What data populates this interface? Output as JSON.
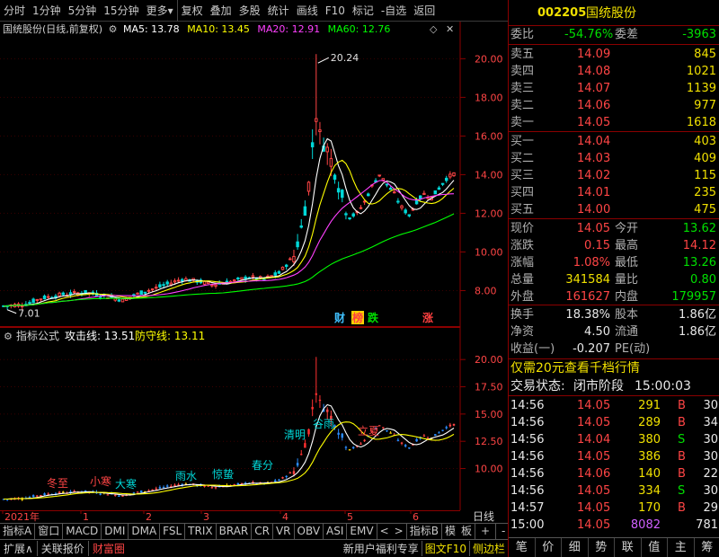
{
  "toolbar": {
    "items": [
      "分时",
      "1分钟",
      "5分钟",
      "15分钟",
      "更多",
      "复权",
      "叠加",
      "多股",
      "统计",
      "画线",
      "F10",
      "标记",
      "-自选",
      "返回"
    ],
    "more_arrow": "▾"
  },
  "main_info": {
    "title": "国统股份(日线,前复权)",
    "ma5": "MA5: 13.78",
    "ma10": "MA10: 13.45",
    "ma20": "MA20: 12.91",
    "ma60": "MA60: 12.76",
    "colors": {
      "ma5": "#ffffff",
      "ma10": "#ffff00",
      "ma20": "#ff40ff",
      "ma60": "#00ff00"
    }
  },
  "main_chart": {
    "y_ticks": [
      "20.00",
      "18.00",
      "16.00",
      "14.00",
      "12.00",
      "10.00",
      "8.00"
    ],
    "y_values": [
      20,
      18,
      16,
      14,
      12,
      10,
      8
    ],
    "high_label": "20.24",
    "low_label": "7.01",
    "ymin": 6.3,
    "ymax": 20.9,
    "markers": [
      {
        "text": "财",
        "color": "#40c0ff"
      },
      {
        "text": "榜",
        "color": "#ff4040",
        "bg": "#ffd000"
      },
      {
        "text": "跌",
        "color": "#00e000"
      },
      {
        "text": "涨",
        "color": "#ff4040"
      }
    ]
  },
  "sub_info": {
    "title": "指标公式",
    "attack": "攻击线: 13.51",
    "defense": "防守线: 13.11"
  },
  "sub_chart": {
    "y_ticks": [
      "20.00",
      "17.50",
      "15.00",
      "12.50",
      "10.00"
    ],
    "y_values": [
      20,
      17.5,
      15,
      12.5,
      10
    ],
    "ymin": 6.5,
    "ymax": 21.5,
    "solar_terms": [
      "冬至",
      "小寒",
      "大寒",
      "雨水",
      "惊蛰",
      "春分",
      "清明",
      "谷雨",
      "立夏"
    ]
  },
  "x_axis": {
    "labels": [
      "2021年",
      "1",
      "2",
      "3",
      "4",
      "5",
      "6"
    ],
    "period": "日线"
  },
  "bottom_tabs": [
    "指标A",
    "窗口",
    "MACD",
    "DMI",
    "DMA",
    "FSL",
    "TRIX",
    "BRAR",
    "CR",
    "VR",
    "OBV",
    "ASI",
    "EMV",
    "指标B",
    "模",
    "板",
    "+",
    "-"
  ],
  "nav_arrows": [
    "<",
    ">"
  ],
  "status": {
    "expand": "扩展∧",
    "associated": "关联报价",
    "wealth": "财富圈",
    "promo": "新用户福利专享",
    "f10": "图文F10",
    "sidebar": "侧边栏"
  },
  "quote": {
    "code": "002205",
    "name": "国统股份",
    "weibi_label": "委比",
    "weibi": "-54.76%",
    "weicha_label": "委差",
    "weicha": "-3963",
    "sells": [
      {
        "label": "卖五",
        "price": "14.09",
        "vol": "845"
      },
      {
        "label": "卖四",
        "price": "14.08",
        "vol": "1021"
      },
      {
        "label": "卖三",
        "price": "14.07",
        "vol": "1139"
      },
      {
        "label": "卖二",
        "price": "14.06",
        "vol": "977"
      },
      {
        "label": "卖一",
        "price": "14.05",
        "vol": "1618"
      }
    ],
    "buys": [
      {
        "label": "买一",
        "price": "14.04",
        "vol": "403"
      },
      {
        "label": "买二",
        "price": "14.03",
        "vol": "409"
      },
      {
        "label": "买三",
        "price": "14.02",
        "vol": "115"
      },
      {
        "label": "买四",
        "price": "14.01",
        "vol": "235"
      },
      {
        "label": "买五",
        "price": "14.00",
        "vol": "475"
      }
    ],
    "stats": [
      {
        "l1": "现价",
        "v1": "14.05",
        "c1": "red",
        "l2": "今开",
        "v2": "13.62",
        "c2": "green"
      },
      {
        "l1": "涨跌",
        "v1": "0.15",
        "c1": "red",
        "l2": "最高",
        "v2": "14.12",
        "c2": "red"
      },
      {
        "l1": "涨幅",
        "v1": "1.08%",
        "c1": "red",
        "l2": "最低",
        "v2": "13.26",
        "c2": "green"
      },
      {
        "l1": "总量",
        "v1": "341584",
        "c1": "yellow",
        "l2": "量比",
        "v2": "0.80",
        "c2": "green"
      },
      {
        "l1": "外盘",
        "v1": "161627",
        "c1": "red",
        "l2": "内盘",
        "v2": "179957",
        "c2": "green"
      }
    ],
    "stats2": [
      {
        "l1": "换手",
        "v1": "18.38%",
        "l2": "股本",
        "v2": "1.86亿"
      },
      {
        "l1": "净资",
        "v1": "4.50",
        "l2": "流通",
        "v2": "1.86亿"
      },
      {
        "l1": "收益(一)",
        "v1": "-0.207",
        "l2": "PE(动)",
        "v2": ""
      }
    ],
    "promo": "仅需20元查看千档行情",
    "trade_status_label": "交易状态:",
    "trade_status": "闭市阶段",
    "trade_time": "15:00:03",
    "ticks": [
      {
        "time": "14:56",
        "price": "14.05",
        "vol": "291",
        "side": "B",
        "n": "30"
      },
      {
        "time": "14:56",
        "price": "14.05",
        "vol": "289",
        "side": "B",
        "n": "34"
      },
      {
        "time": "14:56",
        "price": "14.04",
        "vol": "380",
        "side": "S",
        "n": "30"
      },
      {
        "time": "14:56",
        "price": "14.05",
        "vol": "386",
        "side": "B",
        "n": "30"
      },
      {
        "time": "14:56",
        "price": "14.06",
        "vol": "140",
        "side": "B",
        "n": "22"
      },
      {
        "time": "14:56",
        "price": "14.05",
        "vol": "334",
        "side": "S",
        "n": "30"
      },
      {
        "time": "14:57",
        "price": "14.05",
        "vol": "170",
        "side": "B",
        "n": "29"
      },
      {
        "time": "15:00",
        "price": "14.05",
        "vol": "8082",
        "side": "",
        "n": "781"
      }
    ],
    "side_tabs": [
      "笔",
      "价",
      "细",
      "势",
      "联",
      "值",
      "主",
      "筹"
    ]
  },
  "colors": {
    "up": "#ff4545",
    "down": "#00d8d8",
    "grid": "#8b0000",
    "accent": "#f0e000"
  }
}
